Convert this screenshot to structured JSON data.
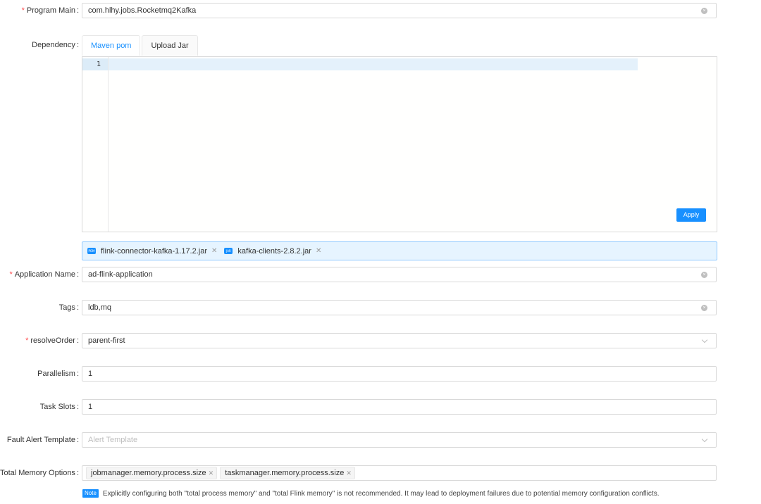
{
  "program_main": {
    "label": "Program Main",
    "value": "com.hlhy.jobs.Rocketmq2Kafka",
    "required": true
  },
  "dependency": {
    "label": "Dependency",
    "tabs": [
      {
        "label": "Maven pom",
        "active": true
      },
      {
        "label": "Upload Jar",
        "active": false
      }
    ],
    "editor": {
      "line_number": "1",
      "apply_label": "Apply"
    },
    "jars": [
      {
        "badge": "POM",
        "name": "flink-connector-kafka-1.17.2.jar"
      },
      {
        "badge": "JAR",
        "name": "kafka-clients-2.8.2.jar"
      }
    ]
  },
  "application_name": {
    "label": "Application Name",
    "value": "ad-flink-application",
    "required": true
  },
  "tags": {
    "label": "Tags",
    "value": "ldb,mq"
  },
  "resolve_order": {
    "label": "resolveOrder",
    "value": "parent-first",
    "required": true
  },
  "parallelism": {
    "label": "Parallelism",
    "value": "1"
  },
  "task_slots": {
    "label": "Task Slots",
    "value": "1"
  },
  "fault_alert": {
    "label": "Fault Alert Template",
    "placeholder": "Alert Template"
  },
  "total_memory": {
    "label": "Total Memory Options",
    "tags": [
      "jobmanager.memory.process.size",
      "taskmanager.memory.process.size"
    ]
  },
  "note": {
    "badge": "Note",
    "text": "Explicitly configuring both \"total process memory\" and \"total Flink memory\" is not recommended. It may lead to deployment failures due to potential memory configuration conflicts."
  },
  "colors": {
    "primary": "#1890ff",
    "required": "#ff4d4f",
    "dep_bg": "#e6f4ff"
  }
}
